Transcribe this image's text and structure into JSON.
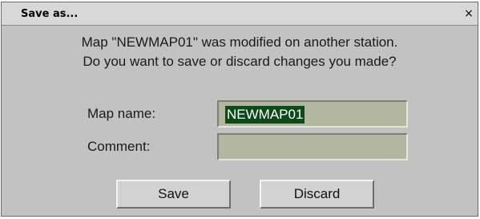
{
  "dialog": {
    "title": "Save as...",
    "close_glyph": "×",
    "message": [
      "Map \"NEWMAP01\" was modified on another station.",
      "Do you want to save or discard changes you made?"
    ]
  },
  "form": {
    "map_name_label": "Map name:",
    "map_name_value": "NEWMAP01",
    "comment_label": "Comment:",
    "comment_value": ""
  },
  "buttons": {
    "save_label": "Save",
    "discard_label": "Discard"
  },
  "colors": {
    "dialog_background": "#c2c2c2",
    "field_background": "#b3b7a0",
    "selection_highlight": "#0c4a1a"
  }
}
